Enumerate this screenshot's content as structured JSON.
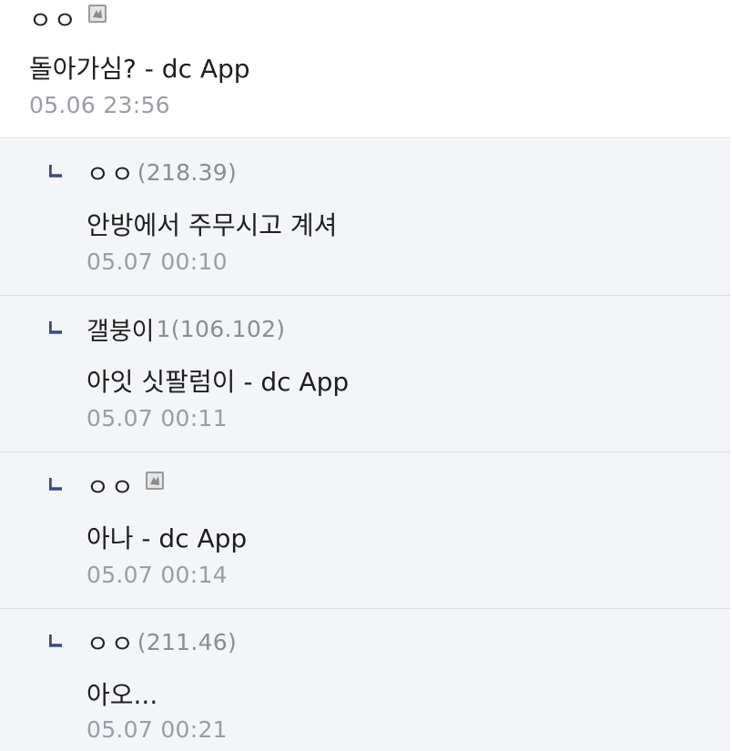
{
  "colors": {
    "reply_background": "#f3f5f8",
    "reply_marker": "#3b4a7d",
    "ip_text": "#8a8d94",
    "timestamp_text": "#9a9da4",
    "divider": "#dcdee4"
  },
  "icons": {
    "fixed_nick": "fixed-nick-badge-icon",
    "reply": "reply-arrow-icon"
  },
  "comment": {
    "nickname": "ㅇㅇ",
    "text": "돌아가심? - dc App",
    "time": "05.06 23:56"
  },
  "replies": [
    {
      "nickname": "ㅇㅇ",
      "ip": "(218.39)",
      "text": "안방에서 주무시고 계셔",
      "time": "05.07 00:10"
    },
    {
      "nickname": "갤붕이",
      "ip": "1(106.102)",
      "text": "아잇 싯팔럼이 - dc App",
      "time": "05.07 00:11"
    },
    {
      "nickname": "ㅇㅇ",
      "ip": "",
      "text": "아나 - dc App",
      "time": "05.07 00:14"
    },
    {
      "nickname": "ㅇㅇ",
      "ip": "(211.46)",
      "text": "아오...",
      "time": "05.07 00:21"
    }
  ]
}
